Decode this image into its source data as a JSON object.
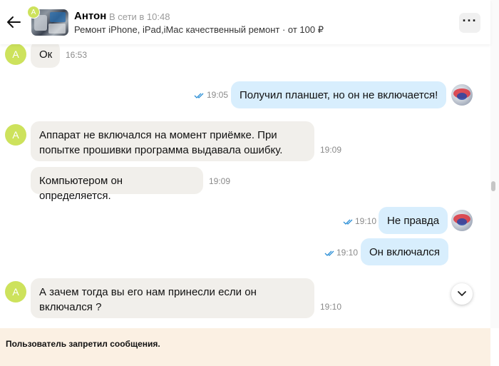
{
  "header": {
    "avatar_letter": "A",
    "name": "Антон",
    "status": "В сети в 10:48",
    "subtitle": "Ремонт iPhone, iPad,iMac качественный ремонт · от 100 ₽",
    "more_label": "···",
    "icons": {
      "back": "arrow-left-icon",
      "more": "more-dots-icon"
    }
  },
  "messages": [
    {
      "dir": "in",
      "avatar_letter": "A",
      "text": "Ок",
      "time": "16:53"
    },
    {
      "dir": "out",
      "text": "Получил планшет,  но он не включается!",
      "time": "19:05",
      "read": true
    },
    {
      "dir": "in",
      "avatar_letter": "A",
      "text": "Аппарат не включался на момент приёмке.  При попытке прошивки программа выдавала ошибку.",
      "time": "19:09"
    },
    {
      "dir": "in",
      "text": "Компьютером он определяется.",
      "time": "19:09"
    },
    {
      "dir": "out",
      "text": "Не правда",
      "time": "19:10",
      "read": true
    },
    {
      "dir": "out",
      "text": "Он включался",
      "time": "19:10",
      "read": true
    },
    {
      "dir": "in",
      "avatar_letter": "A",
      "text": "А зачем тогда вы его нам принесли если он включался ?",
      "time": "19:10"
    }
  ],
  "banner": {
    "text": "Пользователь запретил сообщения."
  },
  "colors": {
    "incoming": "#f1efeb",
    "outgoing": "#d8eefd",
    "avatar": "#cde25c",
    "banner": "#fbf0e3"
  }
}
